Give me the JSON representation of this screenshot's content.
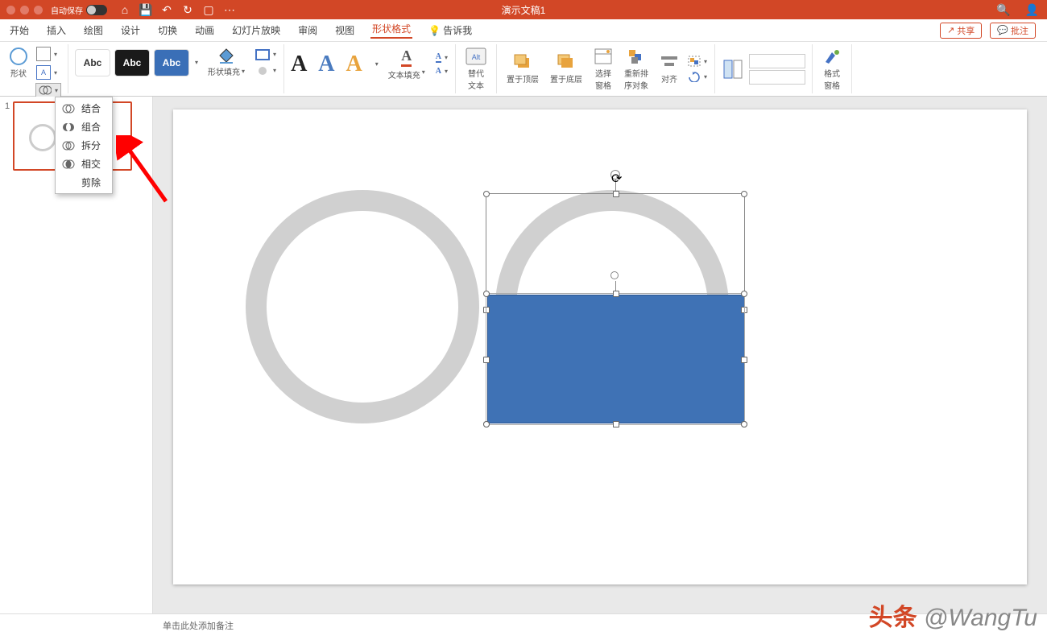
{
  "titlebar": {
    "autosave_label": "自动保存",
    "doc_title": "演示文稿1"
  },
  "qat": {
    "home": "⌂",
    "save": "💾",
    "undo": "↶",
    "redo": "↻",
    "preview": "▢",
    "more": "⋯"
  },
  "tabs": {
    "items": [
      "开始",
      "插入",
      "绘图",
      "设计",
      "切换",
      "动画",
      "幻灯片放映",
      "审阅",
      "视图"
    ],
    "active": "形状格式",
    "tellme": "告诉我",
    "share": "共享",
    "comments": "批注"
  },
  "ribbon": {
    "insert_shape": "形状",
    "edit_shape": "编辑形状",
    "textbox_label": "Abc",
    "merge_shapes": "合并形状",
    "shape_fill": "形状填充",
    "style_label": "Abc",
    "wordart_fill": "文本填充",
    "wordart_icon": "A",
    "alt_text": "替代\n文本",
    "bring_forward": "置于顶层",
    "send_back": "置于底层",
    "selection_pane": "选择\n窗格",
    "group": "重新排\n序对象",
    "align": "对齐",
    "format_pane": "格式\n窗格"
  },
  "dropdown": {
    "items": [
      "结合",
      "组合",
      "拆分",
      "相交",
      "剪除"
    ]
  },
  "slide_panel": {
    "thumb_number": "1"
  },
  "statusbar": {
    "hint": "单击此处添加备注"
  },
  "watermark": {
    "logo_text": "头条",
    "handle": "@WangTu"
  }
}
